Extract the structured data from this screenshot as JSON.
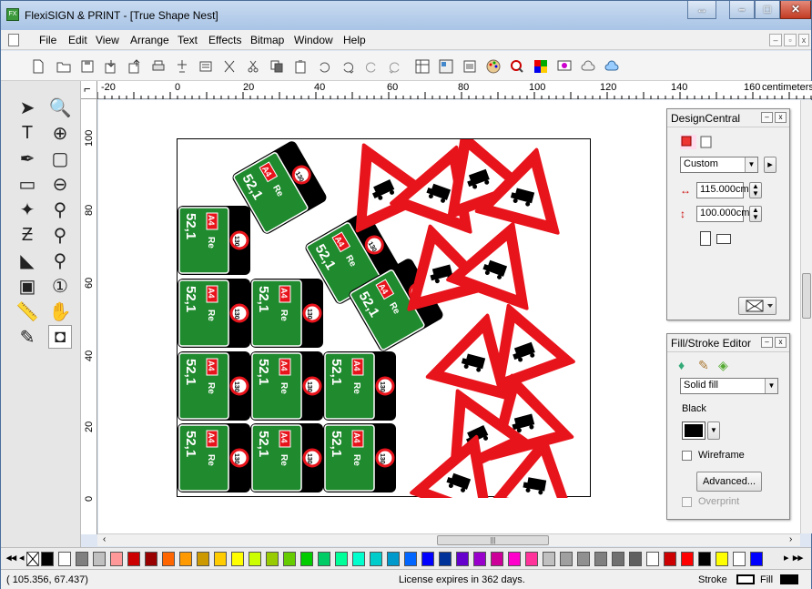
{
  "window": {
    "title": "FlexiSIGN & PRINT - [True Shape Nest]",
    "app_icon": "flexi-app-icon"
  },
  "menu": [
    "File",
    "Edit",
    "View",
    "Arrange",
    "Text",
    "Effects",
    "Bitmap",
    "Window",
    "Help"
  ],
  "ruler": {
    "top_labels": [
      "-20",
      "0",
      "20",
      "40",
      "60",
      "80",
      "100",
      "120",
      "140",
      "160"
    ],
    "unit": "centimeters",
    "left_labels": [
      "100",
      "80",
      "60",
      "40",
      "20",
      "0"
    ]
  },
  "sign": {
    "route": "A4",
    "text": "Re",
    "distance": "52,1",
    "speed": "130"
  },
  "design_central": {
    "title": "DesignCentral",
    "preset": "Custom",
    "width": "115.000cm",
    "height": "100.000cm"
  },
  "fill_stroke": {
    "title": "Fill/Stroke Editor",
    "fill_type": "Solid fill",
    "color_name": "Black",
    "wireframe_label": "Wireframe",
    "advanced_label": "Advanced...",
    "overprint_label": "Overprint"
  },
  "status": {
    "coords": "( 105.356,   67.437)",
    "license": "License expires in 362 days.",
    "stroke_label": "Stroke",
    "fill_label": "Fill"
  },
  "colors": {
    "sign_green": "#1f8a2e",
    "sign_red": "#e8141c",
    "title_bar": "#b7cde8"
  },
  "palette_colors": [
    "#000000",
    "#ffffff",
    "#808080",
    "#c0c0c0",
    "#ff9999",
    "#cc0000",
    "#990000",
    "#ff6600",
    "#ff9900",
    "#cc9900",
    "#ffcc00",
    "#ffff00",
    "#ccff00",
    "#99cc00",
    "#66cc00",
    "#00cc00",
    "#00cc66",
    "#00ff99",
    "#00ffcc",
    "#00cccc",
    "#0099cc",
    "#0066ff",
    "#0000ff",
    "#003399",
    "#6600cc",
    "#9900cc",
    "#cc0099",
    "#ff00cc",
    "#ff3399",
    "#c0c0c0",
    "#a0a0a0",
    "#909090",
    "#808080",
    "#707070",
    "#606060",
    "#ffffff",
    "#cc0000",
    "#ff0000",
    "#000000",
    "#ffff00",
    "#ffffff",
    "#0000ff"
  ]
}
